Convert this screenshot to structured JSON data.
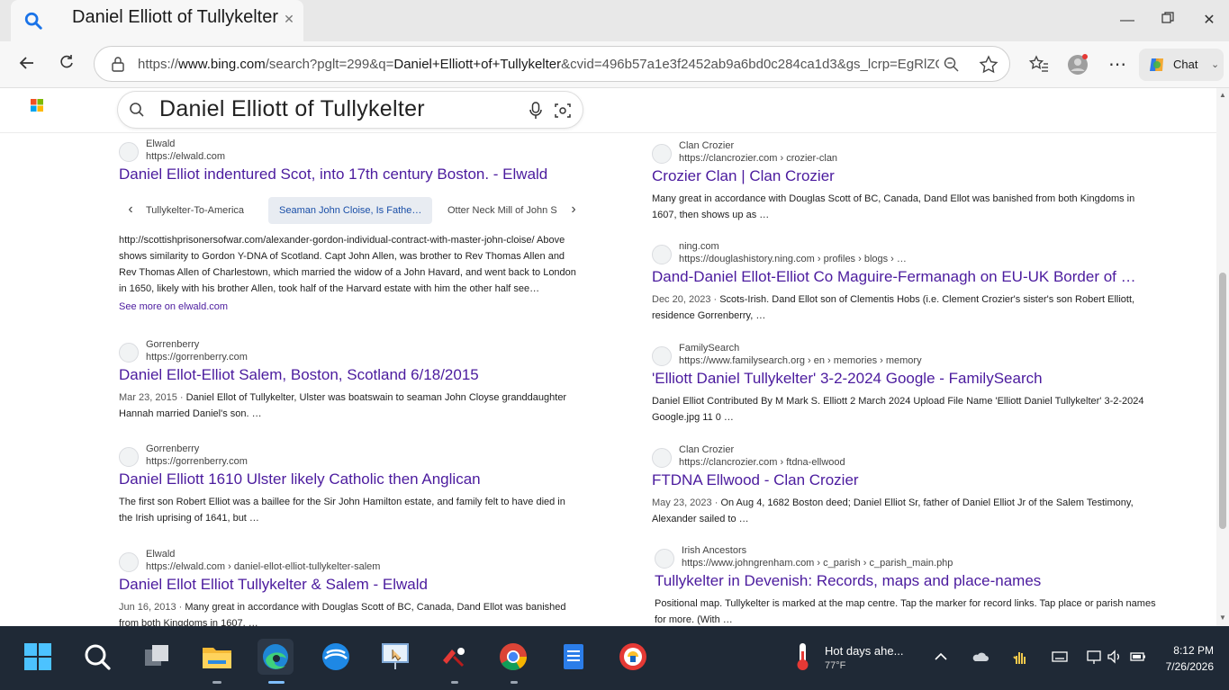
{
  "browser": {
    "tab_title": "Daniel Elliott of Tullykelter",
    "url_prefix": "https://",
    "url_host": "www.bing.com",
    "url_path": "/search?pglt=299&q=",
    "url_query": "Daniel+Elliott+of+Tullykelter",
    "url_rest": "&cvid=496b57a1e3f2452ab9a6bd0c284ca1d3&gs_lcrp=EgRlZGdlKg...",
    "chat_label": "Chat"
  },
  "search": {
    "query": "Daniel Elliott of Tullykelter"
  },
  "left_results": [
    {
      "site_name": "Elwald",
      "site_url": "https://elwald.com",
      "title": "Daniel Elliot indentured Scot, into 17th century Boston. - Elwald",
      "date": "",
      "snippet": "http://scottishprisonersofwar.com/alexander-gordon-individual-contract-with-master-john-cloise/ Above shows similarity to Gordon Y-DNA of Scotland. Capt John Allen, was brother to Rev Thomas Allen and Rev Thomas Allen of Charlestown, which married the widow of a John Havard, and went back to London in 1650, likely with his brother Allen, took half of the Harvard estate with him the other half see…"
    },
    {
      "site_name": "Gorrenberry",
      "site_url": "https://gorrenberry.com",
      "title": "Daniel Ellot-Elliot Salem, Boston, Scotland 6/18/2015",
      "date": "Mar 23, 2015 · ",
      "snippet": "Daniel Ellot of Tullykelter, Ulster was boatswain to seaman John Cloyse granddaughter Hannah married Daniel's son. …"
    },
    {
      "site_name": "Gorrenberry",
      "site_url": "https://gorrenberry.com",
      "title": "Daniel Elliott 1610 Ulster likely Catholic then Anglican",
      "date": "",
      "snippet": "The first son Robert Elliot was a baillee for the Sir John Hamilton estate, and family felt to have died in the Irish uprising of 1641, but …"
    },
    {
      "site_name": "Elwald",
      "site_url": "https://elwald.com › daniel-ellot-elliot-tullykelter-salem",
      "title": "Daniel Ellot Elliot Tullykelter & Salem - Elwald",
      "date": "Jun 16, 2013 · ",
      "snippet": "Many great in accordance with Douglas Scott of BC, Canada, Dand Ellot was banished from both Kingdoms in 1607, …"
    }
  ],
  "carousel": {
    "items": [
      "Tullykelter-To-America",
      "Seaman John Cloise, Is Fathe…",
      "Otter Neck Mill of John S"
    ]
  },
  "see_more": "See more on elwald.com",
  "right_results": [
    {
      "site_name": "Clan Crozier",
      "site_url": "https://clancrozier.com › crozier-clan",
      "title": "Crozier Clan | Clan Crozier",
      "date": "",
      "snippet": "Many great in accordance with Douglas Scott of BC, Canada, Dand Ellot was banished from both Kingdoms in 1607, then shows up as …"
    },
    {
      "site_name": "ning.com",
      "site_url": "https://douglashistory.ning.com › profiles › blogs › …",
      "title": "Dand-Daniel Ellot-Elliot Co Maguire-Fermanagh on EU-UK Border of …",
      "date": "Dec 20, 2023 · ",
      "snippet": "Scots-Irish. Dand Ellot son of Clementis Hobs (i.e. Clement Crozier's sister's son Robert Elliott, residence Gorrenberry, …"
    },
    {
      "site_name": "FamilySearch",
      "site_url": "https://www.familysearch.org › en › memories › memory",
      "title": "'Elliott Daniel Tullykelter' 3-2-2024 Google - FamilySearch",
      "date": "",
      "snippet": "Daniel Elliot Contributed By M Mark S. Elliott 2 March 2024 Upload File Name 'Elliott Daniel Tullykelter' 3-2-2024 Google.jpg 11 0 …"
    },
    {
      "site_name": "Clan Crozier",
      "site_url": "https://clancrozier.com › ftdna-ellwood",
      "title": "FTDNA Ellwood - Clan Crozier",
      "date": "May 23, 2023 · ",
      "snippet": "On Aug 4, 1682 Boston deed; Daniel Elliot Sr, father of Daniel Elliot Jr of the Salem Testimony, Alexander sailed to …"
    },
    {
      "site_name": "Irish Ancestors",
      "site_url": "https://www.johngrenham.com › c_parish › c_parish_main.php",
      "title": "Tullykelter in Devenish: Records, maps and place-names",
      "date": "",
      "snippet": "Positional map. Tullykelter is marked at the map centre. Tap the marker for record links. Tap place or parish names for more. (With …"
    }
  ],
  "taskbar": {
    "weather_text": "Hot days ahe...",
    "temperature": "77°F",
    "time": "8:12 PM",
    "date": "7/26/2026"
  },
  "colors": {
    "link": "#4b1b9e",
    "taskbar": "#1f2936",
    "accent": "#1a73e8"
  }
}
